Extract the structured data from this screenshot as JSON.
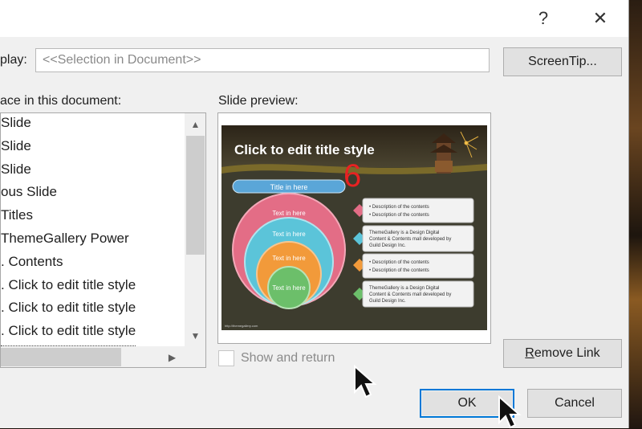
{
  "titlebar": {
    "help": "?",
    "close": "✕"
  },
  "display": {
    "label": "play:",
    "value": "<<Selection in Document>>"
  },
  "screentip_button": "ScreenTip...",
  "place_label": "ace in this document:",
  "preview_label": "Slide preview:",
  "list_items": [
    "Slide",
    "Slide",
    " Slide",
    "ous Slide",
    " Titles",
    "              ThemeGallery Power",
    ". Contents",
    ". Click to edit title style",
    ". Click to edit title style",
    ". Click to edit title style"
  ],
  "slide": {
    "title": "Click to edit title style",
    "number": "6",
    "pill": "Title in here",
    "circles": [
      "Text in here",
      "Text in here",
      "Text in here",
      "Text in here"
    ],
    "boxes": [
      [
        "• Description of the contents",
        "• Description of the contents"
      ],
      [
        "ThemeGallery is a Design Digital",
        "Content & Contents mall developed by",
        "Guild Design Inc."
      ],
      [
        "• Description of the contents",
        "• Description of the contents"
      ],
      [
        "ThemeGallery is a Design Digital",
        "Content & Contents mall developed by",
        "Guild Design Inc."
      ]
    ],
    "footer": "http://themegallery.com"
  },
  "show_and_return": "Show and return",
  "remove_link_button": "Remove Link",
  "ok_button": "OK",
  "cancel_button": "Cancel",
  "colors": {
    "accent": "#0078d7",
    "pill": "#5aa6d8",
    "circle_outer": "#e36d86",
    "circle_2": "#5bc4d9",
    "circle_3": "#f29a3a",
    "circle_inner": "#6cbf6a",
    "number": "#e82222"
  }
}
